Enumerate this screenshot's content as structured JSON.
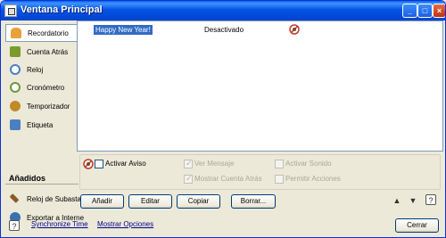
{
  "window": {
    "title": "Ventana Principal",
    "minimize": "_",
    "maximize": "□",
    "close": "×"
  },
  "sidebar": {
    "items": [
      {
        "label": "Recordatorio",
        "icon": "bell-icon",
        "color": "#e8a23a"
      },
      {
        "label": "Cuenta Atrás",
        "icon": "countdown-icon",
        "color": "#7a9a2c"
      },
      {
        "label": "Reloj",
        "icon": "clock-icon",
        "color": "#4a7fc0"
      },
      {
        "label": "Cronómetro",
        "icon": "stopwatch-icon",
        "color": "#6c9a3a"
      },
      {
        "label": "Temporizador",
        "icon": "timer-icon",
        "color": "#c08a28"
      },
      {
        "label": "Etiqueta",
        "icon": "label-icon",
        "color": "#4a7fc0"
      }
    ],
    "section_title": "Añadidos",
    "addons": [
      {
        "label": "Reloj de Subasta",
        "icon": "hammer-icon",
        "color": "#8a5a2b"
      },
      {
        "label": "Exportar a Interne",
        "icon": "export-icon",
        "color": "#3a6fb0"
      }
    ]
  },
  "list": {
    "rows": [
      {
        "name": "Happy New Year!",
        "status": "Desactivado"
      }
    ]
  },
  "options": {
    "activar_aviso": "Activar Aviso",
    "ver_mensaje": "Ver Mensaje",
    "activar_sonido": "Activar Sonido",
    "mostrar_cuenta_atras": "Mostrar Cuenta Atrás",
    "permitir_acciones": "Permitir Acciones"
  },
  "buttons": {
    "add": "Añadir",
    "edit": "Editar",
    "copy": "Copiar",
    "delete": "Borrar...",
    "close": "Cerrar"
  },
  "footer": {
    "sync": "Synchronize Time",
    "show_options": "Mostrar Opciones"
  }
}
